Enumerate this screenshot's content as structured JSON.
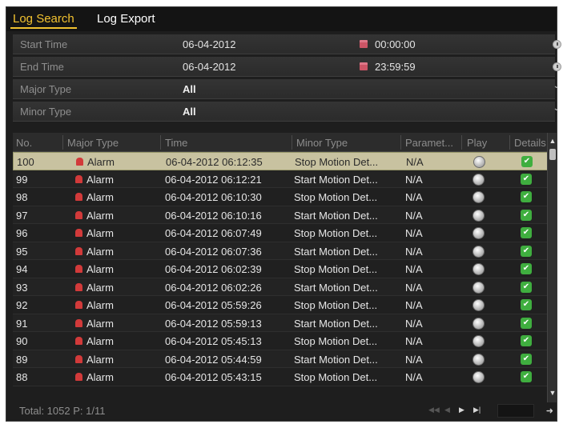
{
  "tabs": [
    {
      "label": "Log Search",
      "active": true
    },
    {
      "label": "Log Export",
      "active": false
    }
  ],
  "filters": {
    "start_time": {
      "label": "Start Time",
      "date": "06-04-2012",
      "time": "00:00:00"
    },
    "end_time": {
      "label": "End Time",
      "date": "06-04-2012",
      "time": "23:59:59"
    },
    "major_type": {
      "label": "Major Type",
      "value": "All"
    },
    "minor_type": {
      "label": "Minor Type",
      "value": "All"
    }
  },
  "table": {
    "headers": [
      "No.",
      "Major Type",
      "Time",
      "Minor Type",
      "Paramet...",
      "Play",
      "Details"
    ],
    "rows": [
      {
        "no": "100",
        "major": "Alarm",
        "time": "06-04-2012 06:12:35",
        "minor": "Stop Motion Det...",
        "param": "N/A",
        "selected": true
      },
      {
        "no": "99",
        "major": "Alarm",
        "time": "06-04-2012 06:12:21",
        "minor": "Start Motion Det...",
        "param": "N/A"
      },
      {
        "no": "98",
        "major": "Alarm",
        "time": "06-04-2012 06:10:30",
        "minor": "Stop Motion Det...",
        "param": "N/A"
      },
      {
        "no": "97",
        "major": "Alarm",
        "time": "06-04-2012 06:10:16",
        "minor": "Start Motion Det...",
        "param": "N/A"
      },
      {
        "no": "96",
        "major": "Alarm",
        "time": "06-04-2012 06:07:49",
        "minor": "Stop Motion Det...",
        "param": "N/A"
      },
      {
        "no": "95",
        "major": "Alarm",
        "time": "06-04-2012 06:07:36",
        "minor": "Start Motion Det...",
        "param": "N/A"
      },
      {
        "no": "94",
        "major": "Alarm",
        "time": "06-04-2012 06:02:39",
        "minor": "Stop Motion Det...",
        "param": "N/A"
      },
      {
        "no": "93",
        "major": "Alarm",
        "time": "06-04-2012 06:02:26",
        "minor": "Start Motion Det...",
        "param": "N/A"
      },
      {
        "no": "92",
        "major": "Alarm",
        "time": "06-04-2012 05:59:26",
        "minor": "Stop Motion Det...",
        "param": "N/A"
      },
      {
        "no": "91",
        "major": "Alarm",
        "time": "06-04-2012 05:59:13",
        "minor": "Start Motion Det...",
        "param": "N/A"
      },
      {
        "no": "90",
        "major": "Alarm",
        "time": "06-04-2012 05:45:13",
        "minor": "Stop Motion Det...",
        "param": "N/A"
      },
      {
        "no": "89",
        "major": "Alarm",
        "time": "06-04-2012 05:44:59",
        "minor": "Start Motion Det...",
        "param": "N/A"
      },
      {
        "no": "88",
        "major": "Alarm",
        "time": "06-04-2012 05:43:15",
        "minor": "Stop Motion Det...",
        "param": "N/A"
      }
    ]
  },
  "footer": {
    "total": "Total: 1052  P: 1/11"
  },
  "icons": {
    "calendar": "calendar-icon",
    "clock": "clock-icon",
    "dropdown": "chevron-down-icon",
    "alarm": "alarm-icon",
    "play": "play-icon",
    "details": "check-icon"
  },
  "colors": {
    "active_tab": "#f2c230",
    "selected_row": "#c8c2a0",
    "alarm": "#d23a3a",
    "details_ok": "#3fae3f"
  }
}
